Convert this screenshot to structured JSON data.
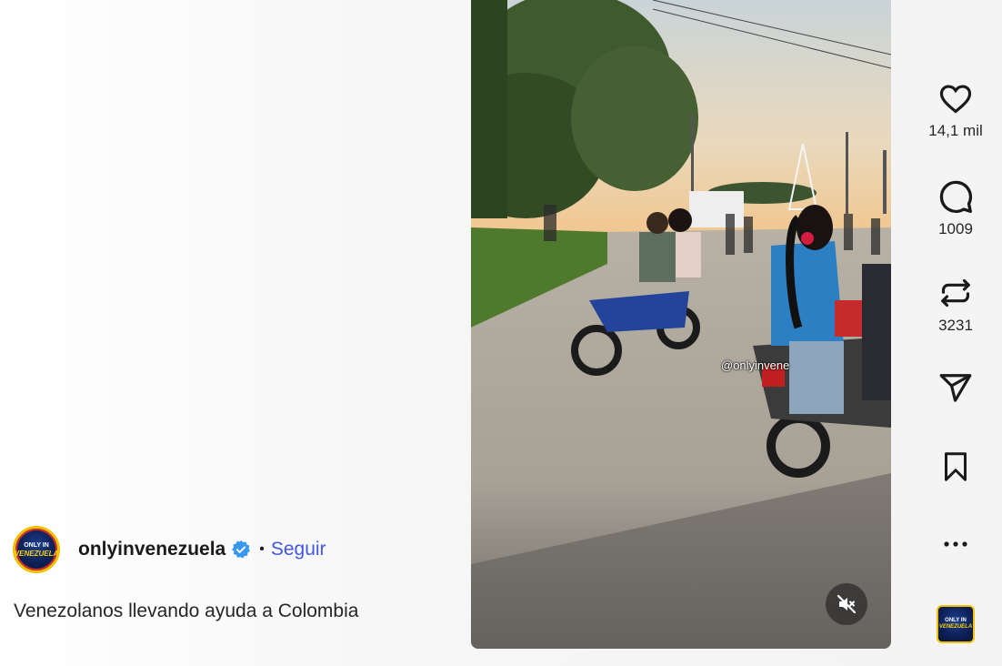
{
  "post": {
    "username": "onlyinvenezuela",
    "separator": "•",
    "follow_label": "Seguir",
    "caption": "Venezolanos llevando ayuda a Colombia",
    "avatar_text_line1": "ONLY IN",
    "avatar_text_line2": "VENEZUELA"
  },
  "video": {
    "watermark": "@onlyinvene",
    "muted": true
  },
  "actions": {
    "likes": "14,1 mil",
    "comments": "1009",
    "reposts": "3231"
  },
  "icons": {
    "verified": "verified-badge-icon",
    "like": "heart-icon",
    "comment": "comment-bubble-icon",
    "repost": "repost-icon",
    "share": "paper-plane-icon",
    "save": "bookmark-icon",
    "more": "more-dots-icon",
    "mute": "speaker-muted-icon"
  },
  "colors": {
    "follow": "#4256e8",
    "verified": "#3897f0",
    "text": "#262626"
  }
}
